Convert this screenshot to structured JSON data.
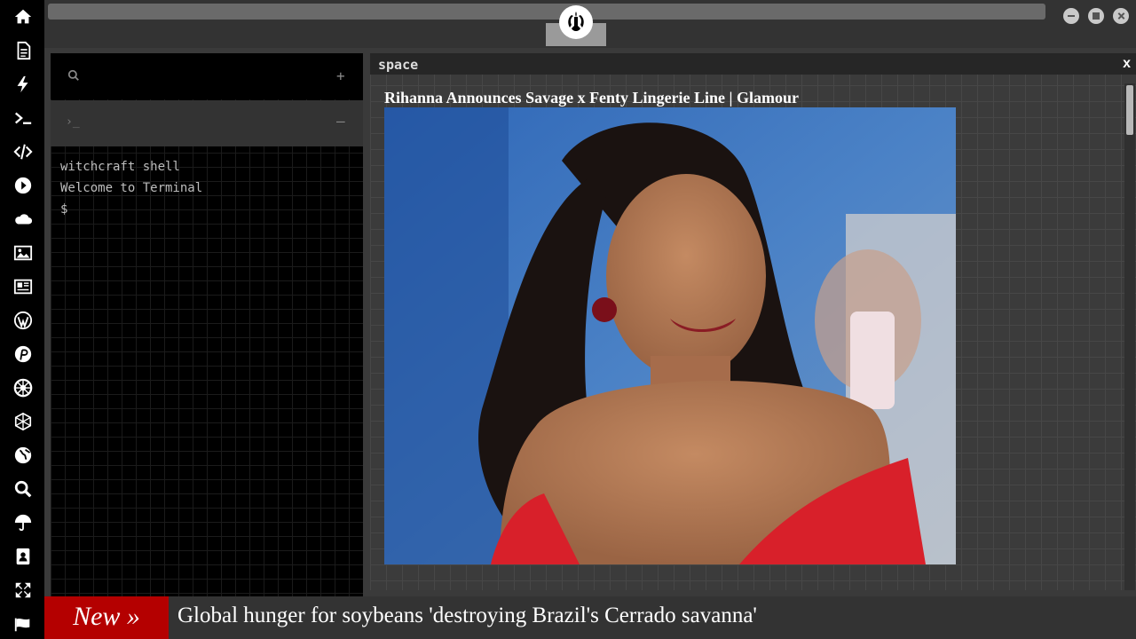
{
  "sidebar": {
    "icons": [
      "home-icon",
      "document-icon",
      "bolt-icon",
      "terminal-icon",
      "code-icon",
      "play-icon",
      "cloud-icon",
      "image-icon",
      "newspaper-icon",
      "wordpress-icon",
      "pinterest-icon",
      "empire-icon",
      "network-icon",
      "globe-icon",
      "search-icon",
      "umbrella-icon",
      "contacts-icon",
      "expand-icon",
      "flag-icon"
    ]
  },
  "terminal": {
    "prompt_placeholder": "›_",
    "lines": [
      "witchcraft shell",
      "Welcome to Terminal",
      "$"
    ]
  },
  "space": {
    "title": "space",
    "close_label": "x",
    "article_title": "Rihanna Announces Savage x Fenty Lingerie Line | Glamour"
  },
  "ticker": {
    "label": "New »",
    "headline": "Global hunger for soybeans 'destroying Brazil's Cerrado savanna'"
  },
  "colors": {
    "sidebar_bg": "#000000",
    "ticker_label_bg": "#b40000",
    "panel_bg": "#3b3b3b"
  }
}
